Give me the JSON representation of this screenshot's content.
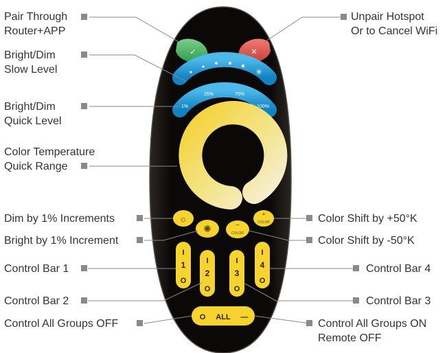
{
  "labels": {
    "pair": [
      "Pair Through",
      "Router+APP"
    ],
    "unpair": [
      "Unpair Hotspot",
      "Or to Cancel WiFi"
    ],
    "slow": [
      "Bright/Dim",
      "Slow Level"
    ],
    "quick": [
      "Bright/Dim",
      "Quick Level"
    ],
    "ct": [
      "Color Temperature",
      "Quick Range"
    ],
    "dim1": "Dim by 1% Increments",
    "bright1": "Bright by 1% Increment",
    "shiftPlus": "Color Shift by +50°K",
    "shiftMinus": "Color Shift by -50°K",
    "bar1": "Control Bar 1",
    "bar2": "Control Bar 2",
    "bar3": "Control Bar 3",
    "bar4": "Control Bar 4",
    "allOff": "Control All Groups OFF",
    "allOn": [
      "Control All Groups ON",
      "Remote OFF"
    ]
  },
  "remote": {
    "quick_ticks": [
      "1%",
      "25%",
      "75%",
      "100%"
    ],
    "color_label": "COLOR",
    "bars": [
      {
        "top": "I",
        "num": "1",
        "bottom": "O"
      },
      {
        "top": "I",
        "num": "2",
        "bottom": "O"
      },
      {
        "top": "I",
        "num": "3",
        "bottom": "O"
      },
      {
        "top": "I",
        "num": "4",
        "bottom": "O"
      }
    ],
    "all": {
      "off": "O",
      "label": "ALL",
      "on": "—"
    }
  },
  "colors": {
    "remote": "#0d0a08",
    "green": "#4bb363",
    "red": "#e0524a",
    "blue": "#1d9ad6",
    "yellow": "#f6d32e",
    "leader": "#8a8a8a",
    "marker": "#8a8a8a"
  }
}
